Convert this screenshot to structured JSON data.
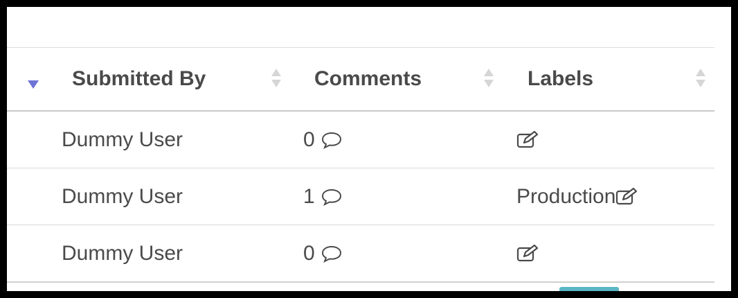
{
  "table": {
    "columns": [
      {
        "label": "Submitted By"
      },
      {
        "label": "Comments"
      },
      {
        "label": "Labels"
      }
    ],
    "rows": [
      {
        "submitted_by": "Dummy User",
        "comments": "0",
        "label": ""
      },
      {
        "submitted_by": "Dummy User",
        "comments": "1",
        "label": "Production"
      },
      {
        "submitted_by": "Dummy User",
        "comments": "0",
        "label": ""
      }
    ]
  },
  "icons": {
    "sort_indicator": "sort-both-icon",
    "active_sort": "sort-desc-icon",
    "comment": "comment-bubble-icon",
    "edit": "edit-icon"
  },
  "colors": {
    "sort_active": "#6f74d6",
    "sort_inactive": "#d6d6d6",
    "text": "#4a4a4a",
    "accent": "#5ab8c4"
  }
}
